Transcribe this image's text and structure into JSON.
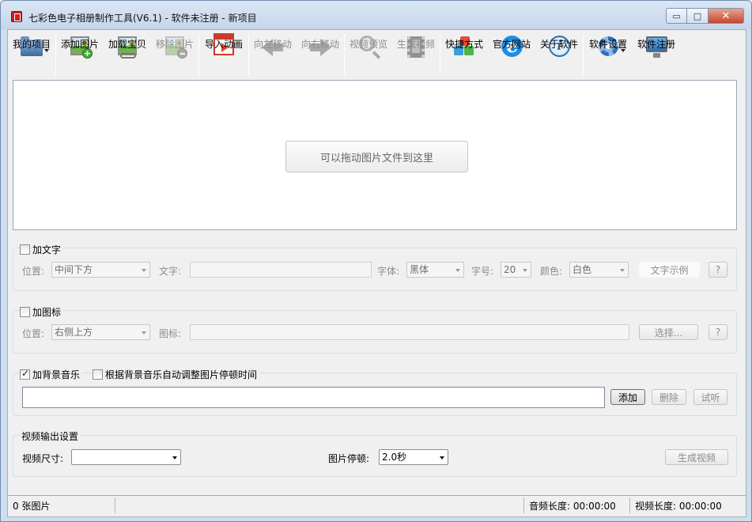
{
  "window": {
    "title": "七彩色电子相册制作工具(V6.1) - 软件未注册 - 新项目",
    "min_symbol": "▭",
    "max_symbol": "□",
    "close_symbol": "✕"
  },
  "toolbar": {
    "my_project": "我的项目",
    "add_image": "添加图片",
    "load_treasure": "加载宝贝",
    "remove_image": "移除图片",
    "import_animation": "导入动画",
    "move_left": "向左移动",
    "move_right": "向右移动",
    "preview_video": "视频预览",
    "generate_video": "生成视频",
    "shortcut": "快捷方式",
    "official_site": "官方网站",
    "about": "关于软件",
    "settings": "软件设置",
    "register": "软件注册",
    "ie_glyph": "e",
    "info_glyph": "i"
  },
  "drop_area": {
    "hint": "可以拖动图片文件到这里"
  },
  "text_group": {
    "checkbox_label": "加文字",
    "checked": false,
    "position_label": "位置:",
    "position_value": "中间下方",
    "text_label": "文字:",
    "text_value": "",
    "font_label": "字体:",
    "font_value": "黑体",
    "size_label": "字号:",
    "size_value": "20",
    "color_label": "颜色:",
    "color_value": "白色",
    "sample_button": "文字示例",
    "help_button": "?"
  },
  "logo_group": {
    "checkbox_label": "加图标",
    "checked": false,
    "position_label": "位置:",
    "position_value": "右侧上方",
    "icon_label": "图标:",
    "icon_value": "",
    "choose_button": "选择...",
    "help_button": "?"
  },
  "music_group": {
    "bg_music_label": "加背景音乐",
    "bg_music_checked": true,
    "auto_adjust_label": "根据背景音乐自动调整图片停顿时间",
    "auto_adjust_checked": false,
    "file_value": "",
    "add_button": "添加",
    "delete_button": "删除",
    "listen_button": "试听"
  },
  "output_group": {
    "title": "视频输出设置",
    "size_label": "视频尺寸:",
    "size_value": "",
    "pause_label": "图片停顿:",
    "pause_value": "2.0秒",
    "generate_button": "生成视频"
  },
  "statusbar": {
    "image_count": "0 张图片",
    "audio_length": "音频长度: 00:00:00",
    "video_length": "视频长度: 00:00:00"
  }
}
